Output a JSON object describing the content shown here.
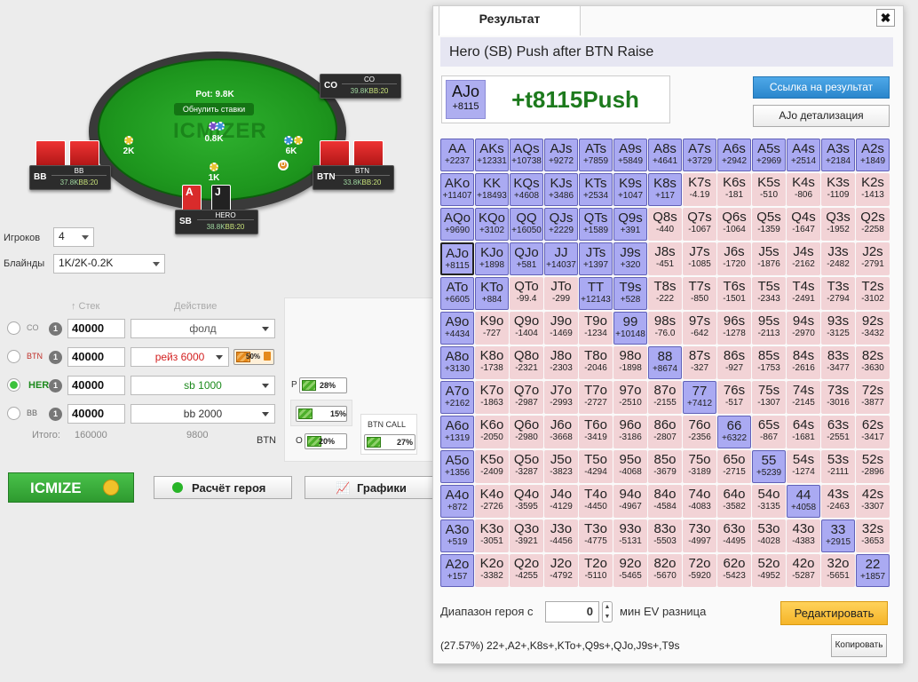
{
  "table": {
    "pot_label": "Pot: 9.8K",
    "reset_label": "Обнулить ставки",
    "center_bet": "0.8K",
    "watermark": "ICMIZER",
    "bets": {
      "bb": "2K",
      "sb": "1K",
      "btn": "6K"
    }
  },
  "seats": {
    "co": {
      "pos": "CO",
      "name": "CO",
      "stack": "39.8K",
      "bb": "BB:20"
    },
    "bb": {
      "pos": "BB",
      "name": "BB",
      "stack": "37.8K",
      "bb": "BB:20"
    },
    "btn": {
      "pos": "BTN",
      "name": "BTN",
      "stack": "33.8K",
      "bb": "BB:20"
    },
    "sb": {
      "pos": "SB",
      "name": "HERO",
      "stack": "38.8K",
      "bb": "BB:20",
      "card1": "A",
      "card2": "J"
    }
  },
  "settings": {
    "players_label": "Игроков",
    "players_value": "4",
    "blinds_label": "Блайнды",
    "blinds_value": "1K/2K-0.2K"
  },
  "columns": {
    "stack": "↑ Стек",
    "action": "Действие"
  },
  "players": [
    {
      "pos": "CO",
      "stack": "40000",
      "action": "фолд"
    },
    {
      "pos": "BTN",
      "stack": "40000",
      "action": "рейз 6000",
      "lock_pct": "50%"
    },
    {
      "pos": "HERO",
      "stack": "40000",
      "action": "sb 1000"
    },
    {
      "pos": "BB",
      "stack": "40000",
      "action": "bb 2000"
    }
  ],
  "totals": {
    "label": "Итого:",
    "stack": "160000",
    "action": "9800"
  },
  "ranges": {
    "p_label": "P",
    "p_value": "28%",
    "mid_value": "15%",
    "o_label": "O",
    "o_value": "20%",
    "btn_label": "BTN",
    "btn_call_label": "BTN CALL",
    "btn_call_value": "27%"
  },
  "buttons": {
    "icmize": "ICMIZE",
    "hero_calc": "Расчёт героя",
    "charts": "Графики"
  },
  "dialog": {
    "tab": "Результат",
    "close": "✖",
    "title": "Hero (SB) Push after BTN Raise",
    "hand": "AJo",
    "hand_ev": "+8115",
    "hand_result": "+t8115Push",
    "link_button": "Ссылка на результат",
    "detail_button": "AJo детализация",
    "range_label": "Диапазон героя с",
    "min_ev_value": "0",
    "min_ev_label": "мин EV разница",
    "edit_button": "Редактировать",
    "range_summary": "(27.57%) 22+,A2+,K8s+,KTo+,Q9s+,QJo,J9s+,T9s",
    "copy_button": "Копировать"
  },
  "grid": [
    [
      [
        "AA",
        "+2237",
        "p"
      ],
      [
        "AKs",
        "+12331",
        "p"
      ],
      [
        "AQs",
        "+10738",
        "p"
      ],
      [
        "AJs",
        "+9272",
        "p"
      ],
      [
        "ATs",
        "+7859",
        "p"
      ],
      [
        "A9s",
        "+5849",
        "p"
      ],
      [
        "A8s",
        "+4641",
        "p"
      ],
      [
        "A7s",
        "+3729",
        "p"
      ],
      [
        "A6s",
        "+2942",
        "p"
      ],
      [
        "A5s",
        "+2969",
        "p"
      ],
      [
        "A4s",
        "+2514",
        "p"
      ],
      [
        "A3s",
        "+2184",
        "p"
      ],
      [
        "A2s",
        "+1849",
        "p"
      ]
    ],
    [
      [
        "AKo",
        "+11407",
        "p"
      ],
      [
        "KK",
        "+18493",
        "p"
      ],
      [
        "KQs",
        "+4608",
        "p"
      ],
      [
        "KJs",
        "+3486",
        "p"
      ],
      [
        "KTs",
        "+2534",
        "p"
      ],
      [
        "K9s",
        "+1047",
        "p"
      ],
      [
        "K8s",
        "+117",
        "p"
      ],
      [
        "K7s",
        "-4.19",
        "f"
      ],
      [
        "K6s",
        "-181",
        "f"
      ],
      [
        "K5s",
        "-510",
        "f"
      ],
      [
        "K4s",
        "-806",
        "f"
      ],
      [
        "K3s",
        "-1109",
        "f"
      ],
      [
        "K2s",
        "-1413",
        "f"
      ]
    ],
    [
      [
        "AQo",
        "+9690",
        "p"
      ],
      [
        "KQo",
        "+3102",
        "p"
      ],
      [
        "QQ",
        "+16050",
        "p"
      ],
      [
        "QJs",
        "+2229",
        "p"
      ],
      [
        "QTs",
        "+1589",
        "p"
      ],
      [
        "Q9s",
        "+391",
        "p"
      ],
      [
        "Q8s",
        "-440",
        "f"
      ],
      [
        "Q7s",
        "-1067",
        "f"
      ],
      [
        "Q6s",
        "-1064",
        "f"
      ],
      [
        "Q5s",
        "-1359",
        "f"
      ],
      [
        "Q4s",
        "-1647",
        "f"
      ],
      [
        "Q3s",
        "-1952",
        "f"
      ],
      [
        "Q2s",
        "-2258",
        "f"
      ]
    ],
    [
      [
        "AJo",
        "+8115",
        "h"
      ],
      [
        "KJo",
        "+1898",
        "p"
      ],
      [
        "QJo",
        "+581",
        "p"
      ],
      [
        "JJ",
        "+14037",
        "p"
      ],
      [
        "JTs",
        "+1397",
        "p"
      ],
      [
        "J9s",
        "+320",
        "p"
      ],
      [
        "J8s",
        "-451",
        "f"
      ],
      [
        "J7s",
        "-1085",
        "f"
      ],
      [
        "J6s",
        "-1720",
        "f"
      ],
      [
        "J5s",
        "-1876",
        "f"
      ],
      [
        "J4s",
        "-2162",
        "f"
      ],
      [
        "J3s",
        "-2482",
        "f"
      ],
      [
        "J2s",
        "-2791",
        "f"
      ]
    ],
    [
      [
        "ATo",
        "+6605",
        "p"
      ],
      [
        "KTo",
        "+884",
        "p"
      ],
      [
        "QTo",
        "-99.4",
        "f"
      ],
      [
        "JTo",
        "-299",
        "f"
      ],
      [
        "TT",
        "+12143",
        "p"
      ],
      [
        "T9s",
        "+528",
        "p"
      ],
      [
        "T8s",
        "-222",
        "f"
      ],
      [
        "T7s",
        "-850",
        "f"
      ],
      [
        "T6s",
        "-1501",
        "f"
      ],
      [
        "T5s",
        "-2343",
        "f"
      ],
      [
        "T4s",
        "-2491",
        "f"
      ],
      [
        "T3s",
        "-2794",
        "f"
      ],
      [
        "T2s",
        "-3102",
        "f"
      ]
    ],
    [
      [
        "A9o",
        "+4434",
        "p"
      ],
      [
        "K9o",
        "-727",
        "f"
      ],
      [
        "Q9o",
        "-1404",
        "f"
      ],
      [
        "J9o",
        "-1469",
        "f"
      ],
      [
        "T9o",
        "-1234",
        "f"
      ],
      [
        "99",
        "+10148",
        "p"
      ],
      [
        "98s",
        "-76.0",
        "f"
      ],
      [
        "97s",
        "-642",
        "f"
      ],
      [
        "96s",
        "-1278",
        "f"
      ],
      [
        "95s",
        "-2113",
        "f"
      ],
      [
        "94s",
        "-2970",
        "f"
      ],
      [
        "93s",
        "-3125",
        "f"
      ],
      [
        "92s",
        "-3432",
        "f"
      ]
    ],
    [
      [
        "A8o",
        "+3130",
        "p"
      ],
      [
        "K8o",
        "-1738",
        "f"
      ],
      [
        "Q8o",
        "-2321",
        "f"
      ],
      [
        "J8o",
        "-2303",
        "f"
      ],
      [
        "T8o",
        "-2046",
        "f"
      ],
      [
        "98o",
        "-1898",
        "f"
      ],
      [
        "88",
        "+8674",
        "p"
      ],
      [
        "87s",
        "-327",
        "f"
      ],
      [
        "86s",
        "-927",
        "f"
      ],
      [
        "85s",
        "-1753",
        "f"
      ],
      [
        "84s",
        "-2616",
        "f"
      ],
      [
        "83s",
        "-3477",
        "f"
      ],
      [
        "82s",
        "-3630",
        "f"
      ]
    ],
    [
      [
        "A7o",
        "+2162",
        "p"
      ],
      [
        "K7o",
        "-1863",
        "f"
      ],
      [
        "Q7o",
        "-2987",
        "f"
      ],
      [
        "J7o",
        "-2993",
        "f"
      ],
      [
        "T7o",
        "-2727",
        "f"
      ],
      [
        "97o",
        "-2510",
        "f"
      ],
      [
        "87o",
        "-2155",
        "f"
      ],
      [
        "77",
        "+7412",
        "p"
      ],
      [
        "76s",
        "-517",
        "f"
      ],
      [
        "75s",
        "-1307",
        "f"
      ],
      [
        "74s",
        "-2145",
        "f"
      ],
      [
        "73s",
        "-3016",
        "f"
      ],
      [
        "72s",
        "-3877",
        "f"
      ]
    ],
    [
      [
        "A6o",
        "+1319",
        "p"
      ],
      [
        "K6o",
        "-2050",
        "f"
      ],
      [
        "Q6o",
        "-2980",
        "f"
      ],
      [
        "J6o",
        "-3668",
        "f"
      ],
      [
        "T6o",
        "-3419",
        "f"
      ],
      [
        "96o",
        "-3186",
        "f"
      ],
      [
        "86o",
        "-2807",
        "f"
      ],
      [
        "76o",
        "-2356",
        "f"
      ],
      [
        "66",
        "+6322",
        "p"
      ],
      [
        "65s",
        "-867",
        "f"
      ],
      [
        "64s",
        "-1681",
        "f"
      ],
      [
        "63s",
        "-2551",
        "f"
      ],
      [
        "62s",
        "-3417",
        "f"
      ]
    ],
    [
      [
        "A5o",
        "+1356",
        "p"
      ],
      [
        "K5o",
        "-2409",
        "f"
      ],
      [
        "Q5o",
        "-3287",
        "f"
      ],
      [
        "J5o",
        "-3823",
        "f"
      ],
      [
        "T5o",
        "-4294",
        "f"
      ],
      [
        "95o",
        "-4068",
        "f"
      ],
      [
        "85o",
        "-3679",
        "f"
      ],
      [
        "75o",
        "-3189",
        "f"
      ],
      [
        "65o",
        "-2715",
        "f"
      ],
      [
        "55",
        "+5239",
        "p"
      ],
      [
        "54s",
        "-1274",
        "f"
      ],
      [
        "53s",
        "-2111",
        "f"
      ],
      [
        "52s",
        "-2896",
        "f"
      ]
    ],
    [
      [
        "A4o",
        "+872",
        "p"
      ],
      [
        "K4o",
        "-2726",
        "f"
      ],
      [
        "Q4o",
        "-3595",
        "f"
      ],
      [
        "J4o",
        "-4129",
        "f"
      ],
      [
        "T4o",
        "-4450",
        "f"
      ],
      [
        "94o",
        "-4967",
        "f"
      ],
      [
        "84o",
        "-4584",
        "f"
      ],
      [
        "74o",
        "-4083",
        "f"
      ],
      [
        "64o",
        "-3582",
        "f"
      ],
      [
        "54o",
        "-3135",
        "f"
      ],
      [
        "44",
        "+4058",
        "p"
      ],
      [
        "43s",
        "-2463",
        "f"
      ],
      [
        "42s",
        "-3307",
        "f"
      ]
    ],
    [
      [
        "A3o",
        "+519",
        "p"
      ],
      [
        "K3o",
        "-3051",
        "f"
      ],
      [
        "Q3o",
        "-3921",
        "f"
      ],
      [
        "J3o",
        "-4456",
        "f"
      ],
      [
        "T3o",
        "-4775",
        "f"
      ],
      [
        "93o",
        "-5131",
        "f"
      ],
      [
        "83o",
        "-5503",
        "f"
      ],
      [
        "73o",
        "-4997",
        "f"
      ],
      [
        "63o",
        "-4495",
        "f"
      ],
      [
        "53o",
        "-4028",
        "f"
      ],
      [
        "43o",
        "-4383",
        "f"
      ],
      [
        "33",
        "+2915",
        "p"
      ],
      [
        "32s",
        "-3653",
        "f"
      ]
    ],
    [
      [
        "A2o",
        "+157",
        "p"
      ],
      [
        "K2o",
        "-3382",
        "f"
      ],
      [
        "Q2o",
        "-4255",
        "f"
      ],
      [
        "J2o",
        "-4792",
        "f"
      ],
      [
        "T2o",
        "-5110",
        "f"
      ],
      [
        "92o",
        "-5465",
        "f"
      ],
      [
        "82o",
        "-5670",
        "f"
      ],
      [
        "72o",
        "-5920",
        "f"
      ],
      [
        "62o",
        "-5423",
        "f"
      ],
      [
        "52o",
        "-4952",
        "f"
      ],
      [
        "42o",
        "-5287",
        "f"
      ],
      [
        "32o",
        "-5651",
        "f"
      ],
      [
        "22",
        "+1857",
        "p"
      ]
    ]
  ]
}
